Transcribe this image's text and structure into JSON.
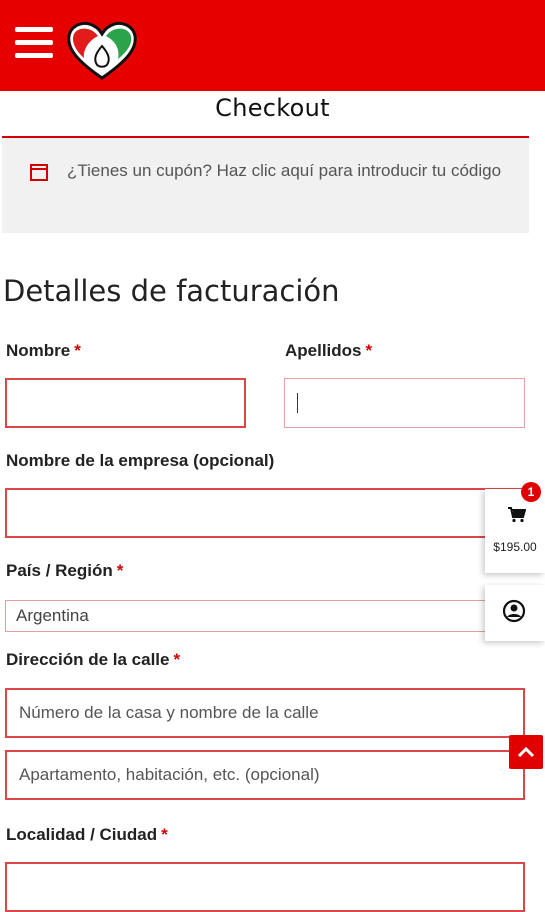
{
  "header": {
    "menu_icon": "hamburger-menu-icon",
    "logo_icon": "heart-logo-icon",
    "colors": {
      "brand_red": "#e60000",
      "logo_green": "#2aa34a",
      "logo_red": "#e21b1b"
    }
  },
  "page": {
    "title": "Checkout"
  },
  "coupon": {
    "icon": "coupon-icon",
    "text": "¿Tienes un cupón? Haz clic aquí para introducir tu código"
  },
  "billing": {
    "section_title": "Detalles de facturación",
    "required_marker": "*",
    "fields": {
      "first_name": {
        "label": "Nombre",
        "value": ""
      },
      "last_name": {
        "label": "Apellidos",
        "value": ""
      },
      "company": {
        "label": "Nombre de la empresa (opcional)",
        "value": ""
      },
      "country": {
        "label": "País / Región",
        "selected": "Argentina"
      },
      "street": {
        "label": "Dirección de la calle",
        "line1_placeholder": "Número de la casa y nombre de la calle",
        "line2_placeholder": "Apartamento, habitación, etc. (opcional)"
      },
      "city": {
        "label": "Localidad / Ciudad",
        "value": ""
      }
    }
  },
  "side_cart": {
    "badge_count": "1",
    "total": "$195.00",
    "cart_icon": "cart-icon",
    "account_icon": "account-icon"
  },
  "scroll_top": {
    "icon": "chevron-up-icon"
  }
}
